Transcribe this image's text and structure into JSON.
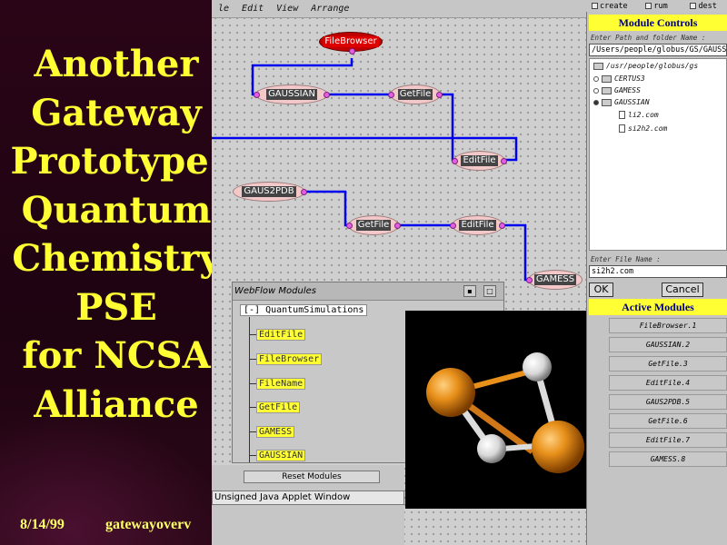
{
  "slide": {
    "title_lines": [
      "Another",
      "Gateway",
      "Prototype:",
      "Quantum",
      "Chemistry",
      "PSE",
      "for NCSA",
      "Alliance"
    ],
    "date": "8/14/99",
    "filename": "gatewayoverv"
  },
  "menu": [
    "le",
    "Edit",
    "View",
    "Arrange"
  ],
  "nodes": {
    "filebrowser": "FileBrowser",
    "gaussian": "GAUSSIAN",
    "getfile1": "GetFile",
    "editfile1": "EditFile",
    "gaus2pdb": "GAUS2PDB",
    "getfile2": "GetFile",
    "editfile2": "EditFile",
    "gamess": "GAMESS"
  },
  "modules_window": {
    "title": "WebFlow Modules",
    "root": "[-] QuantumSimulations",
    "items": [
      "EditFile",
      "FileBrowser",
      "FileName",
      "GetFile",
      "GAMESS",
      "GAUSSIAN"
    ]
  },
  "reset_label": "Reset Modules",
  "applet_label": "Unsigned Java Applet Window",
  "colors": {
    "slide_title": "#ffff33",
    "wire": "#0000ee",
    "header_bg": "#ffff33",
    "header_text": "#000080"
  },
  "right_panel": {
    "toolbar": [
      "create",
      "rum",
      "dest"
    ],
    "module_controls": "Module Controls",
    "path_label": "Enter Path and folder Name :",
    "path_value": "/Users/people/globus/GS/GAUSSIAN",
    "tree": {
      "root": "/usr/people/globus/gs",
      "folders": [
        "CERTUS3",
        "GAMESS",
        "GAUSSIAN"
      ],
      "files": [
        "li2.com",
        "si2h2.com"
      ]
    },
    "filename_label": "Enter File Name :",
    "filename_value": "si2h2.com",
    "ok": "OK",
    "cancel": "Cancel",
    "active_modules": "Active Modules",
    "active_items": [
      "FileBrowser.1",
      "GAUSSIAN.2",
      "GetFile.3",
      "EditFile.4",
      "GAUS2PDB.5",
      "GetFile.6",
      "EditFile.7",
      "GAMESS.8"
    ]
  }
}
